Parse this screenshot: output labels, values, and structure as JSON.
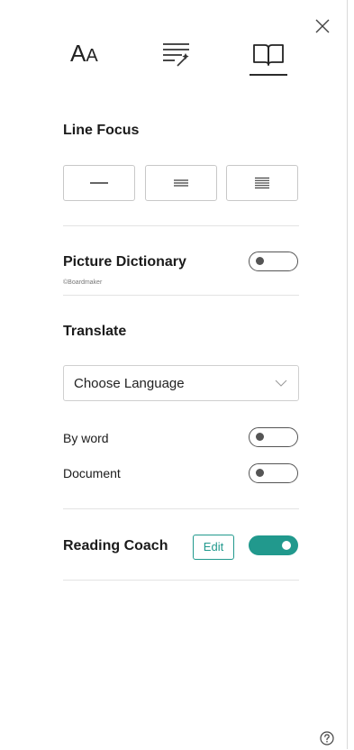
{
  "tabs": [
    {
      "name": "text-size-tab",
      "label": "AA"
    },
    {
      "name": "text-options-tab"
    },
    {
      "name": "reading-preferences-tab",
      "active": true
    }
  ],
  "line_focus": {
    "title": "Line Focus",
    "options": [
      "one-line",
      "three-lines",
      "five-lines"
    ]
  },
  "picture_dictionary": {
    "title": "Picture Dictionary",
    "credit": "©Boardmaker",
    "enabled": false
  },
  "translate": {
    "title": "Translate",
    "language_placeholder": "Choose Language",
    "by_word_label": "By word",
    "by_word_enabled": false,
    "document_label": "Document",
    "document_enabled": false
  },
  "reading_coach": {
    "title": "Reading Coach",
    "edit_label": "Edit",
    "enabled": true
  },
  "colors": {
    "accent": "#21998d",
    "text": "#1b1b1b",
    "border": "#c8c8c8"
  },
  "icons": [
    "close-icon",
    "text-size-icon",
    "text-options-icon",
    "book-icon",
    "chevron-down-icon",
    "help-icon"
  ]
}
